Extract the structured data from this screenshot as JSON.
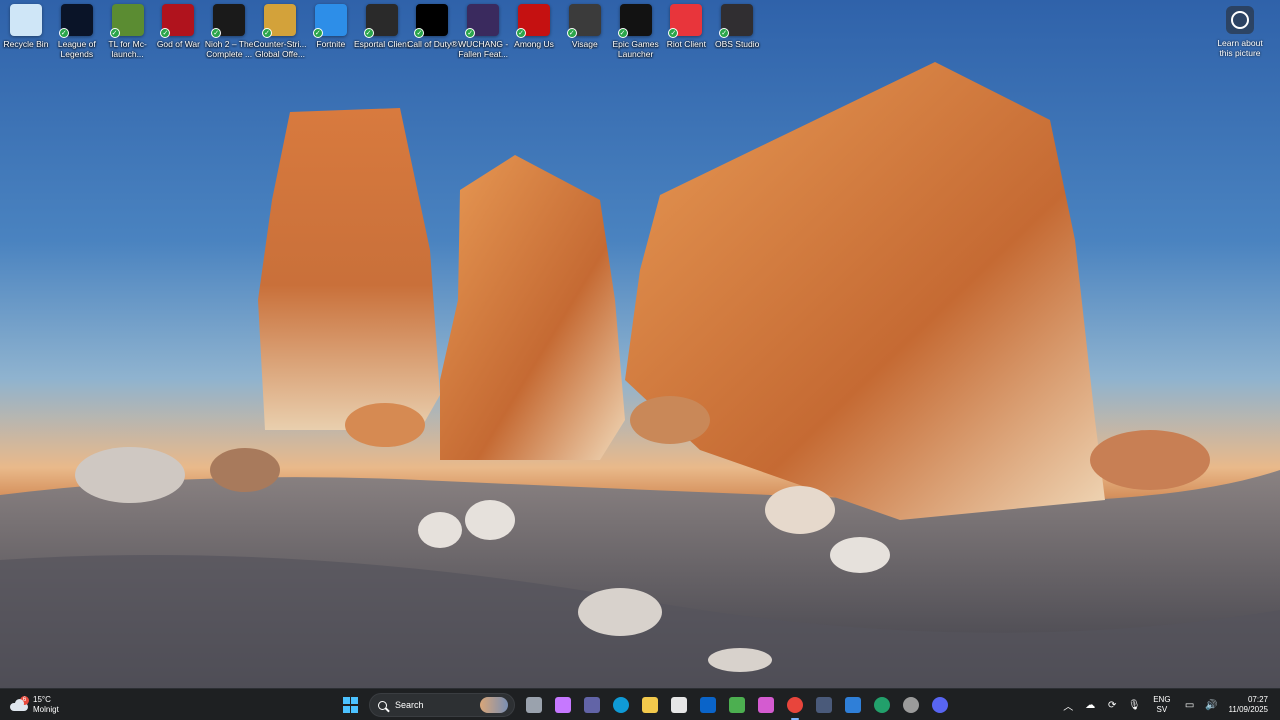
{
  "desktop": {
    "icons": [
      {
        "name": "recycle-bin",
        "label": "Recycle Bin",
        "icon": "recycle-bin-icon",
        "color": "#cfe6f7"
      },
      {
        "name": "league-of-legends",
        "label": "League of Legends",
        "icon": "league-of-legends-icon",
        "color": "#0a1428"
      },
      {
        "name": "tl-launcher",
        "label": "TL for Mc-launch...",
        "icon": "minecraft-grass-icon",
        "color": "#5b8c32"
      },
      {
        "name": "god-of-war",
        "label": "God of War",
        "icon": "god-of-war-omega-icon",
        "color": "#b0131d"
      },
      {
        "name": "nioh-2",
        "label": "Nioh 2 – The Complete ...",
        "icon": "nioh-icon",
        "color": "#1a1a1a"
      },
      {
        "name": "counter-strike",
        "label": "Counter-Stri... Global Offe...",
        "icon": "csgo-icon",
        "color": "#d3a23a"
      },
      {
        "name": "fortnite",
        "label": "Fortnite",
        "icon": "fortnite-icon",
        "color": "#2d8ee8"
      },
      {
        "name": "esportal",
        "label": "Esportal Client",
        "icon": "esportal-icon",
        "color": "#2a2a2a"
      },
      {
        "name": "call-of-duty",
        "label": "Call of Duty®",
        "icon": "call-of-duty-icon",
        "color": "#000000"
      },
      {
        "name": "wuchang",
        "label": "WUCHANG - Fallen Feat...",
        "icon": "wuchang-icon",
        "color": "#3a2a5e"
      },
      {
        "name": "among-us",
        "label": "Among Us",
        "icon": "among-us-icon",
        "color": "#c51111"
      },
      {
        "name": "visage",
        "label": "Visage",
        "icon": "visage-icon",
        "color": "#3b3b3b"
      },
      {
        "name": "epic-games",
        "label": "Epic Games Launcher",
        "icon": "epic-games-icon",
        "color": "#121212"
      },
      {
        "name": "riot-client",
        "label": "Riot Client",
        "icon": "riot-fist-icon",
        "color": "#e8353b"
      },
      {
        "name": "obs-studio",
        "label": "OBS Studio",
        "icon": "obs-icon",
        "color": "#302e31"
      }
    ],
    "learn_label": "Learn about this picture"
  },
  "taskbar": {
    "weather": {
      "temp": "15°C",
      "desc": "Molnigt",
      "badge": "6"
    },
    "search_placeholder": "Search",
    "apps": [
      {
        "name": "task-view",
        "color": "#9aa2ad"
      },
      {
        "name": "copilot",
        "color": "#c678ff"
      },
      {
        "name": "teams",
        "color": "#6264a7"
      },
      {
        "name": "edge",
        "color": "#0f9ad6"
      },
      {
        "name": "file-explorer",
        "color": "#f2c94c"
      },
      {
        "name": "microsoft-store",
        "color": "#e6e6e6"
      },
      {
        "name": "outlook",
        "color": "#0a64c9"
      },
      {
        "name": "shield-app",
        "color": "#4caf50"
      },
      {
        "name": "m365",
        "color": "#d45bd0"
      },
      {
        "name": "chrome",
        "color": "#e8453c"
      },
      {
        "name": "dev-app",
        "color": "#4a5a7a"
      },
      {
        "name": "photos",
        "color": "#2f7fd8"
      },
      {
        "name": "update-app",
        "color": "#22a06b"
      },
      {
        "name": "obs",
        "color": "#9b9b9b"
      },
      {
        "name": "discord",
        "color": "#5865f2"
      }
    ],
    "lang": {
      "line1": "ENG",
      "line2": "SV"
    },
    "clock": {
      "time": "07:27",
      "date": "11/09/2025"
    }
  }
}
